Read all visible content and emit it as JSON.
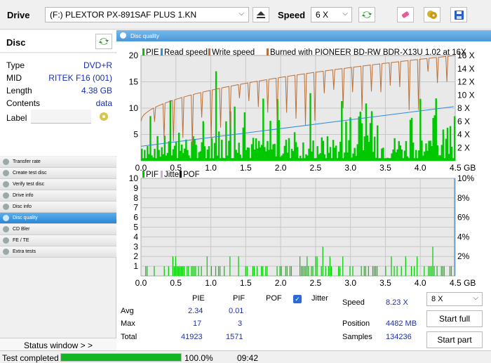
{
  "toolbar": {
    "drive_label": "Drive",
    "drive_value": "(F:)   PLEXTOR PX-891SAF PLUS 1.KN",
    "speed_label": "Speed",
    "speed_value": "6 X"
  },
  "disc": {
    "header": "Disc",
    "rows": [
      {
        "key": "Type",
        "value": "DVD+R"
      },
      {
        "key": "MID",
        "value": "RITEK F16 (001)"
      },
      {
        "key": "Length",
        "value": "4.38 GB"
      },
      {
        "key": "Contents",
        "value": "data"
      },
      {
        "key": "Label",
        "value": ""
      }
    ]
  },
  "nav": {
    "items": [
      {
        "label": "Transfer rate",
        "active": false
      },
      {
        "label": "Create test disc",
        "active": false
      },
      {
        "label": "Verify test disc",
        "active": false
      },
      {
        "label": "Drive info",
        "active": false
      },
      {
        "label": "Disc info",
        "active": false
      },
      {
        "label": "Disc quality",
        "active": true
      },
      {
        "label": "CD Bler",
        "active": false
      },
      {
        "label": "FE / TE",
        "active": false
      },
      {
        "label": "Extra tests",
        "active": false
      }
    ],
    "status_window": "Status window > >"
  },
  "panel": {
    "title": "Disc quality"
  },
  "chart_data": [
    {
      "type": "bar",
      "title": "",
      "legend": [
        "PIE",
        "Read speed",
        "Write speed",
        "Burned with PIONEER BD-RW   BDR-X13U 1.02 at 16X"
      ],
      "x_ticks": [
        "0.0",
        "0.5",
        "1.0",
        "1.5",
        "2.0",
        "2.5",
        "3.0",
        "3.5",
        "4.0",
        "4.5 GB"
      ],
      "y_left_ticks": [
        "20",
        "15",
        "10",
        "5"
      ],
      "y_right_ticks": [
        "16 X",
        "14 X",
        "12 X",
        "10 X",
        "8 X",
        "6 X",
        "4 X",
        "2 X"
      ],
      "xlim": [
        0,
        4.5
      ],
      "ylim": [
        0,
        20
      ],
      "y2lim": [
        0,
        16
      ],
      "series": [
        {
          "name": "PIE",
          "color": "#00c800",
          "max": 17,
          "avg": 2.34
        },
        {
          "name": "Read speed",
          "color": "#2a8be0",
          "start": 2.2,
          "end": 8.23
        },
        {
          "name": "Write speed",
          "color": "#b8703a",
          "start": 6.0,
          "end": 16.0
        }
      ]
    },
    {
      "type": "bar",
      "title": "",
      "legend": [
        "PIF",
        "Jitter",
        "POF"
      ],
      "x_ticks": [
        "0.0",
        "0.5",
        "1.0",
        "1.5",
        "2.0",
        "2.5",
        "3.0",
        "3.5",
        "4.0",
        "4.5 GB"
      ],
      "y_left_ticks": [
        "10",
        "9",
        "8",
        "7",
        "6",
        "5",
        "4",
        "3",
        "2",
        "1"
      ],
      "y_right_ticks": [
        "10%",
        "8%",
        "6%",
        "4%",
        "2%"
      ],
      "xlim": [
        0,
        4.5
      ],
      "ylim": [
        0,
        10
      ],
      "series": [
        {
          "name": "PIF",
          "color": "#00c800",
          "max": 3,
          "avg": 0.01
        }
      ]
    }
  ],
  "stats": {
    "col_pie": "PIE",
    "col_pif": "PIF",
    "col_pof": "POF",
    "jitter_label": "Jitter",
    "avg_label": "Avg",
    "max_label": "Max",
    "total_label": "Total",
    "avg_pie": "2.34",
    "avg_pif": "0.01",
    "max_pie": "17",
    "max_pif": "3",
    "total_pie": "41923",
    "total_pif": "1571",
    "speed_label": "Speed",
    "speed_value": "8.23 X",
    "position_label": "Position",
    "position_value": "4482 MB",
    "samples_label": "Samples",
    "samples_value": "134236",
    "speed_select": "8 X",
    "start_full": "Start full",
    "start_part": "Start part"
  },
  "statusbar": {
    "text": "Test completed",
    "progress_pct": 100,
    "progress_label": "100.0%",
    "time": "09:42"
  }
}
